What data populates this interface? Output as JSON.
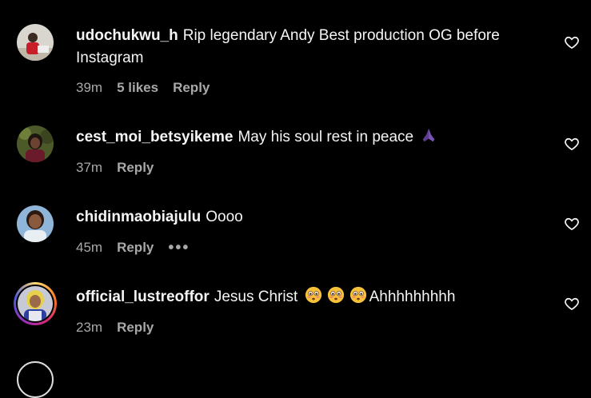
{
  "comments": [
    {
      "username": "udochukwu_h",
      "text": "Rip legendary Andy Best production OG before Instagram",
      "time": "39m",
      "likes": "5 likes",
      "reply": "Reply"
    },
    {
      "username": "cest_moi_betsyikeme",
      "text": "May his soul rest in peace",
      "emoji": "praying-hands-emoji",
      "time": "37m",
      "reply": "Reply"
    },
    {
      "username": "chidinmaobiajulu",
      "text": "Oooo",
      "time": "45m",
      "reply": "Reply",
      "more": "•••"
    },
    {
      "username": "official_lustreoffor",
      "text_before": "Jesus Christ",
      "emoji": "flushed-face-emoji",
      "text_after": "Ahhhhhhhhh",
      "time": "23m",
      "reply": "Reply"
    }
  ],
  "colors": {
    "background": "#000000",
    "text": "#f5f5f5",
    "secondary": "#a8a8a8"
  }
}
